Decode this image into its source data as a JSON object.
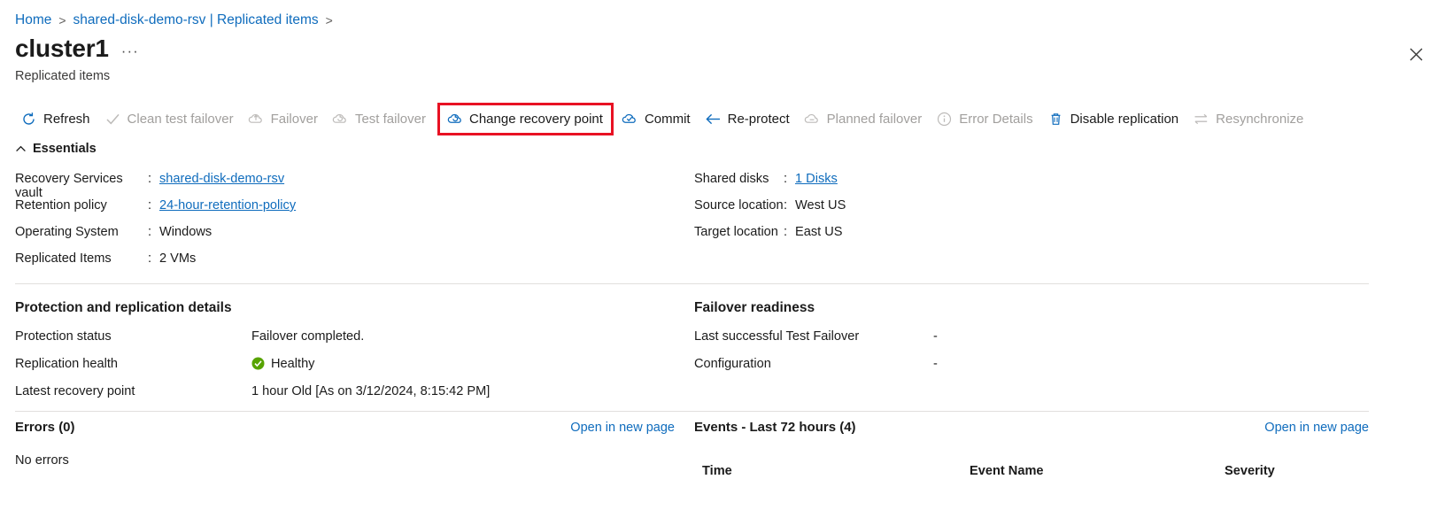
{
  "breadcrumb": {
    "items": [
      {
        "label": "Home",
        "sep": ">"
      },
      {
        "label": "shared-disk-demo-rsv | Replicated items",
        "sep": ">"
      }
    ]
  },
  "header": {
    "title": "cluster1",
    "ellipsis": "···",
    "subtitle": "Replicated items",
    "close_icon": "close-icon"
  },
  "toolbar": {
    "highlight_color": "#e81123",
    "accent_color": "#0f6cbd",
    "commands": [
      {
        "label": "Refresh",
        "icon": "refresh-icon",
        "disabled": false,
        "highlighted": false
      },
      {
        "label": "Clean test failover",
        "icon": "checkmark-icon",
        "disabled": true,
        "highlighted": false
      },
      {
        "label": "Failover",
        "icon": "cloud-arrow-icon",
        "disabled": true,
        "highlighted": false
      },
      {
        "label": "Test failover",
        "icon": "cloud-test-icon",
        "disabled": true,
        "highlighted": false
      },
      {
        "label": "Change recovery point",
        "icon": "cloud-recovery-icon",
        "disabled": false,
        "highlighted": true
      },
      {
        "label": "Commit",
        "icon": "cloud-check-icon",
        "disabled": false,
        "highlighted": false
      },
      {
        "label": "Re-protect",
        "icon": "arrow-left-icon",
        "disabled": false,
        "highlighted": false
      },
      {
        "label": "Planned failover",
        "icon": "cloud-planned-icon",
        "disabled": true,
        "highlighted": false
      },
      {
        "label": "Error Details",
        "icon": "info-circle-icon",
        "disabled": true,
        "highlighted": false
      },
      {
        "label": "Disable replication",
        "icon": "trash-icon",
        "disabled": false,
        "highlighted": false
      },
      {
        "label": "Resynchronize",
        "icon": "resync-arrows-icon",
        "disabled": true,
        "highlighted": false
      }
    ]
  },
  "essentials": {
    "heading": "Essentials",
    "chevron_icon": "chevron-up-icon",
    "left": [
      {
        "key": "Recovery Services vault",
        "colon": ":",
        "value": "shared-disk-demo-rsv",
        "link": true
      },
      {
        "key": "Retention policy",
        "colon": ":",
        "value": "24-hour-retention-policy",
        "link": true
      },
      {
        "key": "Operating System",
        "colon": ":",
        "value": "Windows",
        "link": false
      },
      {
        "key": "Replicated Items",
        "colon": ":",
        "value": "2 VMs",
        "link": false
      }
    ],
    "right": [
      {
        "key": "Shared disks",
        "colon": ":",
        "value": "1 Disks",
        "link": true
      },
      {
        "key": "Source location",
        "colon": ":",
        "value": "West US",
        "link": false
      },
      {
        "key": "Target location",
        "colon": ":",
        "value": "East US",
        "link": false
      }
    ]
  },
  "protection": {
    "title": "Protection and replication details",
    "rows": [
      {
        "key": "Protection status",
        "value": "Failover completed."
      },
      {
        "key": "Replication health",
        "value": "Healthy",
        "status_icon": "health-check-icon",
        "status_color": "#57a300"
      },
      {
        "key": "Latest recovery point",
        "value": "1 hour Old [As on 3/12/2024, 8:15:42 PM]"
      }
    ]
  },
  "failover_readiness": {
    "title": "Failover readiness",
    "rows": [
      {
        "key": "Last successful Test Failover",
        "value": "-"
      },
      {
        "key": "Configuration",
        "value": "-"
      }
    ]
  },
  "errors_panel": {
    "title": "Errors (0)",
    "open_link": "Open in new page",
    "empty_text": "No errors"
  },
  "events_panel": {
    "title": "Events - Last 72 hours (4)",
    "open_link": "Open in new page",
    "columns": {
      "time": "Time",
      "event_name": "Event Name",
      "severity": "Severity"
    }
  }
}
